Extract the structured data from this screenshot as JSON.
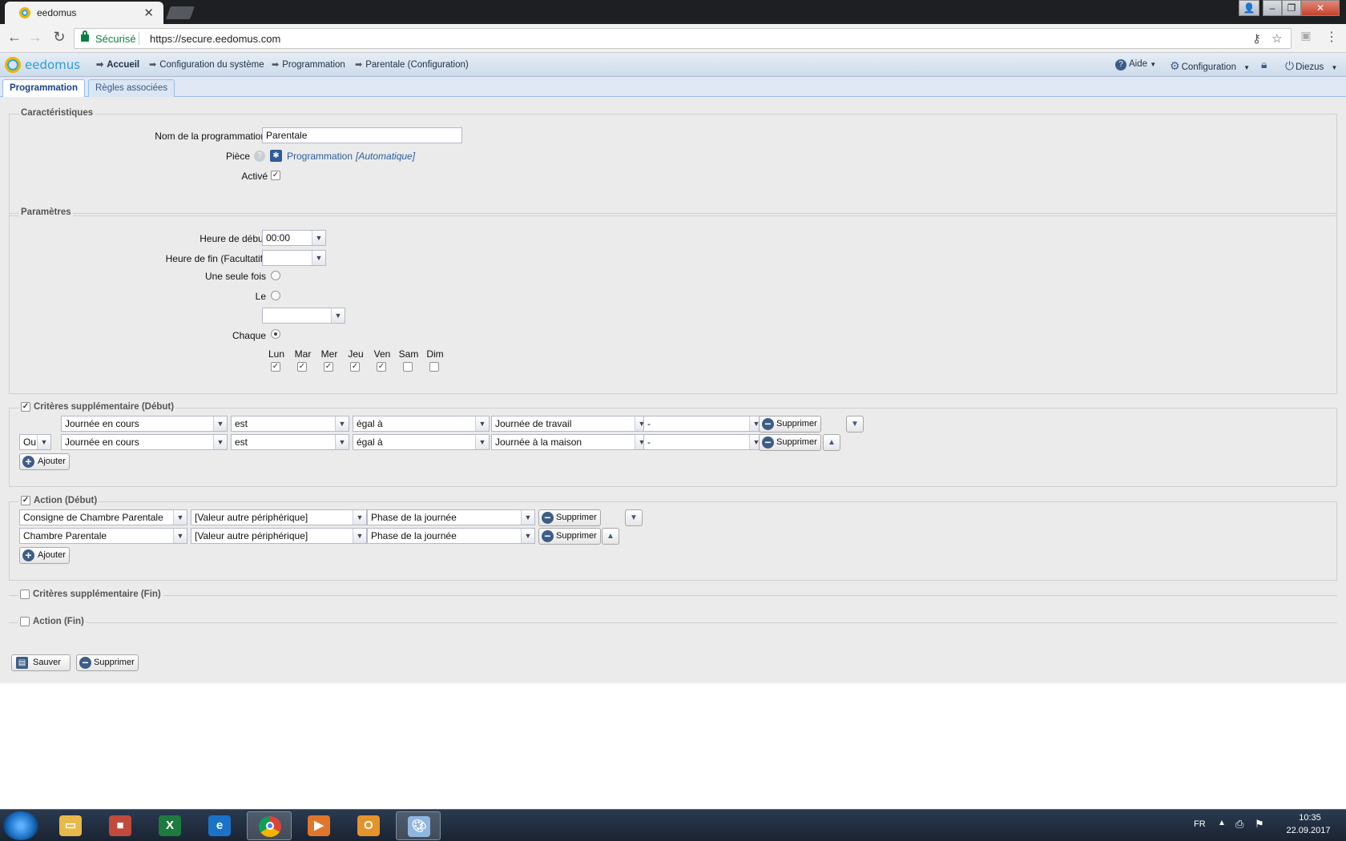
{
  "browser": {
    "tab_title": "eedomus",
    "secure_label": "Sécurisé",
    "url": "https://secure.eedomus.com"
  },
  "app": {
    "logo_text": "eedomus",
    "breadcrumb": [
      "Accueil",
      "Configuration du système",
      "Programmation",
      "Parentale (Configuration)"
    ],
    "menu": {
      "help": "Aide",
      "config": "Configuration",
      "user": "Diezus"
    },
    "tabs": [
      "Programmation",
      "Règles associées"
    ]
  },
  "caracteristiques": {
    "legend": "Caractéristiques",
    "name_label": "Nom de la programmation",
    "name_value": "Parentale",
    "piece_label": "Pièce",
    "piece_value": "Programmation",
    "piece_auto": "[Automatique]",
    "active_label": "Activé",
    "active": true
  },
  "parametres": {
    "legend": "Paramètres",
    "start_label": "Heure de début",
    "start_value": "00:00",
    "end_label": "Heure de fin (Facultatif)",
    "end_value": "",
    "once_label": "Une seule fois",
    "le_label": "Le",
    "chaque_label": "Chaque",
    "days": [
      {
        "label": "Lun",
        "checked": true
      },
      {
        "label": "Mar",
        "checked": true
      },
      {
        "label": "Mer",
        "checked": true
      },
      {
        "label": "Jeu",
        "checked": true
      },
      {
        "label": "Ven",
        "checked": true
      },
      {
        "label": "Sam",
        "checked": false
      },
      {
        "label": "Dim",
        "checked": false
      }
    ]
  },
  "criteres_debut": {
    "legend": "Critères supplémentaire (Début)",
    "rows": [
      {
        "op": "",
        "a": "Journée en cours",
        "b": "est",
        "c": "égal à",
        "d": "Journée de travail",
        "e": "-"
      },
      {
        "op": "Ou",
        "a": "Journée en cours",
        "b": "est",
        "c": "égal à",
        "d": "Journée à la maison",
        "e": "-"
      }
    ],
    "delete_label": "Supprimer",
    "add_label": "Ajouter"
  },
  "action_debut": {
    "legend": "Action (Début)",
    "rows": [
      {
        "a": "Consigne de Chambre Parentale",
        "b": "[Valeur autre périphérique]",
        "c": "Phase de la journée"
      },
      {
        "a": "Chambre Parentale",
        "b": "[Valeur autre périphérique]",
        "c": "Phase de la journée"
      }
    ],
    "delete_label": "Supprimer",
    "add_label": "Ajouter"
  },
  "criteres_fin": {
    "legend": "Critères supplémentaire (Fin)"
  },
  "action_fin": {
    "legend": "Action (Fin)"
  },
  "footer": {
    "save": "Sauver",
    "delete": "Supprimer"
  },
  "taskbar": {
    "lang": "FR",
    "time": "10:35",
    "date": "22.09.2017"
  }
}
